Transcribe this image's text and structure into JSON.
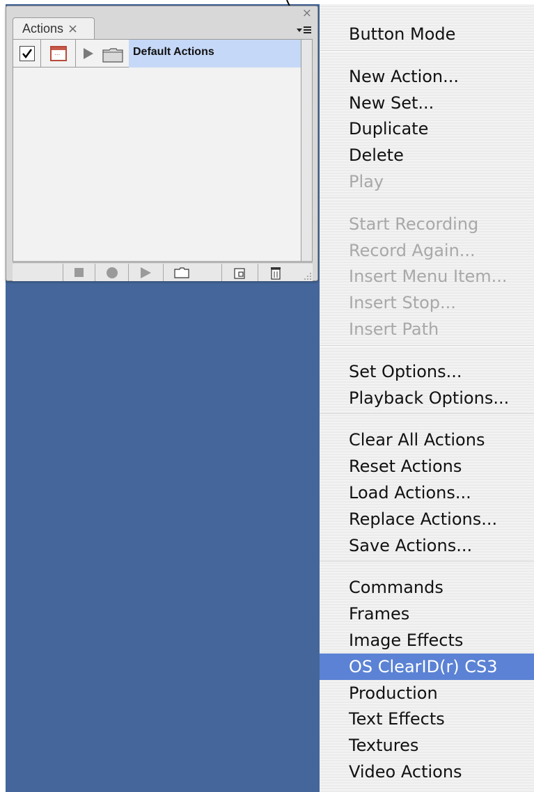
{
  "panel": {
    "tab_label": "Actions",
    "tab_close_glyph": "×",
    "close_glyph": "×",
    "row": {
      "label": "Default Actions",
      "checked": true
    },
    "icons": [
      "checkmark-icon",
      "dialog-toggle-icon",
      "expand-triangle-icon",
      "folder-icon"
    ],
    "toolbar": [
      "stop-icon",
      "record-icon",
      "play-icon",
      "new-set-icon",
      "new-action-icon",
      "trash-icon"
    ]
  },
  "menu": {
    "groups": [
      [
        {
          "label": "Button Mode",
          "enabled": true
        }
      ],
      [
        {
          "label": "New Action...",
          "enabled": true
        },
        {
          "label": "New Set...",
          "enabled": true
        },
        {
          "label": "Duplicate",
          "enabled": true
        },
        {
          "label": "Delete",
          "enabled": true
        },
        {
          "label": "Play",
          "enabled": false
        }
      ],
      [
        {
          "label": "Start Recording",
          "enabled": false
        },
        {
          "label": "Record Again...",
          "enabled": false
        },
        {
          "label": "Insert Menu Item...",
          "enabled": false
        },
        {
          "label": "Insert Stop...",
          "enabled": false
        },
        {
          "label": "Insert Path",
          "enabled": false
        }
      ],
      [
        {
          "label": "Set Options...",
          "enabled": true
        },
        {
          "label": "Playback Options...",
          "enabled": true
        }
      ],
      [
        {
          "label": "Clear All Actions",
          "enabled": true
        },
        {
          "label": "Reset Actions",
          "enabled": true
        },
        {
          "label": "Load Actions...",
          "enabled": true
        },
        {
          "label": "Replace Actions...",
          "enabled": true
        },
        {
          "label": "Save Actions...",
          "enabled": true
        }
      ],
      [
        {
          "label": "Commands",
          "enabled": true
        },
        {
          "label": "Frames",
          "enabled": true
        },
        {
          "label": "Image Effects",
          "enabled": true
        },
        {
          "label": "OS ClearID(r) CS3",
          "enabled": true,
          "highlighted": true
        },
        {
          "label": "Production",
          "enabled": true
        },
        {
          "label": "Text Effects",
          "enabled": true
        },
        {
          "label": "Textures",
          "enabled": true
        },
        {
          "label": "Video Actions",
          "enabled": true
        }
      ]
    ]
  },
  "colors": {
    "desktop": "#44669a",
    "highlight": "#5b82d4",
    "row_selection": "#c6d8f7",
    "disabled_text": "#a8a8a8"
  }
}
